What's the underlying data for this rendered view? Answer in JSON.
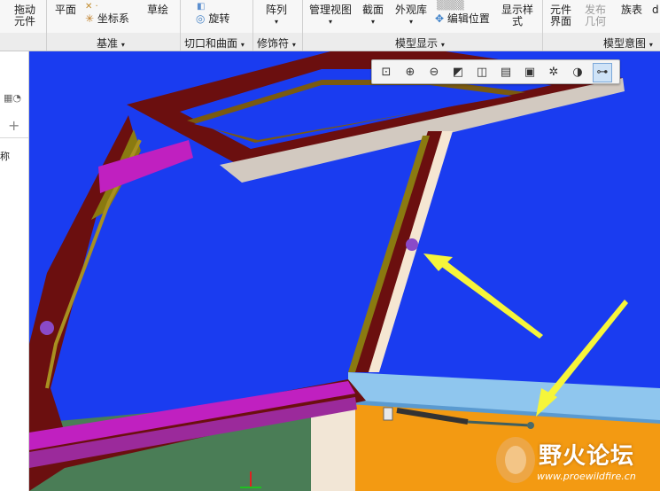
{
  "ribbon": {
    "drag_components": "拖动\n元件",
    "plane": "平面",
    "coordinate_system": "坐标系",
    "sketch": "草绘",
    "revolve": "旋转",
    "pattern": "阵列",
    "manage_views": "管理视图",
    "section": "截面",
    "appearance_gallery": "外观库",
    "edit_position": "编辑位置",
    "display_style": "显示样\n式",
    "component_interface": "元件\n界面",
    "publish_geometry": "发布\n几何",
    "family_table": "族表",
    "cut_char": "d"
  },
  "groups": {
    "datum": "基准",
    "cut_and_surface": "切口和曲面",
    "modifiers": "修饰符",
    "model_display": "模型显示",
    "model_intent": "模型意图"
  },
  "left_panel": {
    "label": "称"
  },
  "view_toolbar": {
    "icons": [
      "zoom-window-icon",
      "zoom-in-icon",
      "zoom-out-icon",
      "repaint-icon",
      "view-style-icon",
      "saved-views-icon",
      "view-manager-icon",
      "datum-display-icon",
      "annotation-display-icon",
      "spin-center-icon"
    ],
    "active_index": 9
  },
  "watermark": {
    "text": "野火论坛",
    "url": "www.proewildfire.cn"
  },
  "colors": {
    "viewport": "#1a3cf0",
    "frame": "#6b0f0f",
    "magenta": "#c020c0",
    "arrow": "#f6f53a",
    "orange": "#f39a12"
  }
}
